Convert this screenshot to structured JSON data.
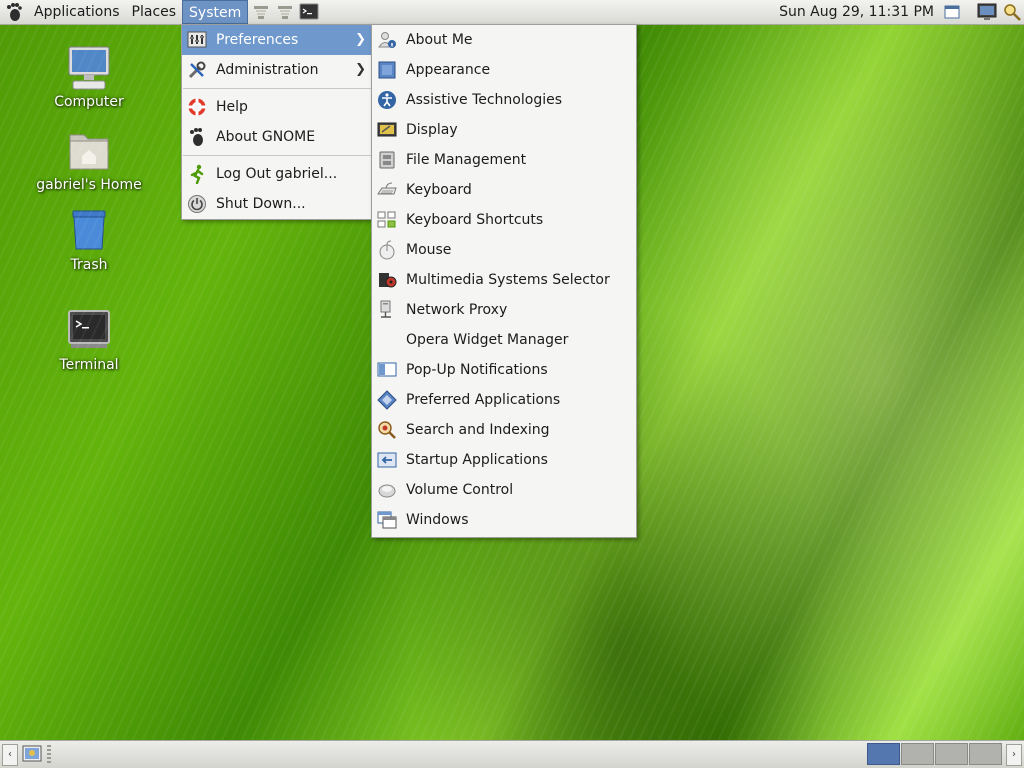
{
  "top_panel": {
    "menus": [
      "Applications",
      "Places",
      "System"
    ],
    "clock": "Sun Aug 29, 11:31 PM"
  },
  "desktop": {
    "icons": [
      {
        "label": "Computer",
        "icon": "computer-icon"
      },
      {
        "label": "gabriel's Home",
        "icon": "home-folder-icon"
      },
      {
        "label": "Trash",
        "icon": "trash-icon"
      },
      {
        "label": "Terminal",
        "icon": "terminal-icon"
      }
    ]
  },
  "system_menu": {
    "items": [
      {
        "label": "Preferences",
        "icon": "preferences-icon",
        "submenu": true
      },
      {
        "label": "Administration",
        "icon": "administration-icon",
        "submenu": true
      },
      {
        "label": "Help",
        "icon": "help-icon"
      },
      {
        "label": "About GNOME",
        "icon": "gnome-foot-icon"
      },
      {
        "label": "Log Out gabriel...",
        "icon": "logout-icon"
      },
      {
        "label": "Shut Down...",
        "icon": "shutdown-icon"
      }
    ]
  },
  "preferences_menu": {
    "items": [
      {
        "label": "About Me",
        "icon": "about-me-icon"
      },
      {
        "label": "Appearance",
        "icon": "appearance-icon"
      },
      {
        "label": "Assistive Technologies",
        "icon": "accessibility-icon"
      },
      {
        "label": "Display",
        "icon": "display-icon"
      },
      {
        "label": "File Management",
        "icon": "file-management-icon"
      },
      {
        "label": "Keyboard",
        "icon": "keyboard-icon"
      },
      {
        "label": "Keyboard Shortcuts",
        "icon": "keyboard-shortcuts-icon"
      },
      {
        "label": "Mouse",
        "icon": "mouse-icon"
      },
      {
        "label": "Multimedia Systems Selector",
        "icon": "multimedia-icon"
      },
      {
        "label": "Network Proxy",
        "icon": "network-proxy-icon"
      },
      {
        "label": "Opera Widget Manager",
        "icon": ""
      },
      {
        "label": "Pop-Up Notifications",
        "icon": "notifications-icon"
      },
      {
        "label": "Preferred Applications",
        "icon": "preferred-apps-icon"
      },
      {
        "label": "Search and Indexing",
        "icon": "search-indexing-icon"
      },
      {
        "label": "Startup Applications",
        "icon": "startup-icon"
      },
      {
        "label": "Volume Control",
        "icon": "volume-icon"
      },
      {
        "label": "Windows",
        "icon": "windows-icon"
      }
    ]
  },
  "bottom_panel": {
    "workspaces": 4,
    "active_workspace": 1
  },
  "colors": {
    "menu_highlight": "#6f98cc",
    "panel_active": "#6d93c4",
    "desktop_green": "#5aa80b"
  }
}
